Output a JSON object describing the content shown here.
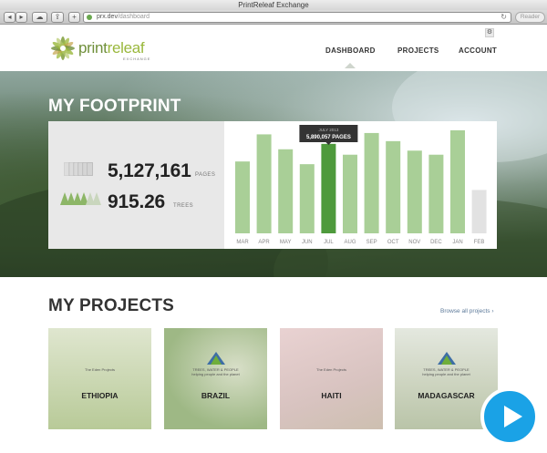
{
  "browser": {
    "window_title": "PrintReleaf Exchange",
    "url_host": "prx.dev",
    "url_path": "/dashboard",
    "reader_label": "Reader"
  },
  "header": {
    "logo_word_1": "print",
    "logo_word_2": "releaf",
    "logo_sub": "EXCHANGE",
    "nav": [
      {
        "label": "DASHBOARD",
        "active": true
      },
      {
        "label": "PROJECTS",
        "active": false
      },
      {
        "label": "ACCOUNT",
        "active": false
      }
    ]
  },
  "footprint": {
    "title": "MY FOOTPRINT",
    "pages_value": "5,127,161",
    "pages_unit": "PAGES",
    "trees_value": "915.26",
    "trees_unit": "TREES"
  },
  "chart_data": {
    "type": "bar",
    "categories": [
      "MAR",
      "APR",
      "MAY",
      "JUN",
      "JUL",
      "AUG",
      "SEP",
      "OCT",
      "NOV",
      "DEC",
      "JAN",
      "FEB"
    ],
    "series": [
      {
        "values": [
          5.3,
          7.3,
          6.2,
          5.1,
          6.6,
          5.8,
          7.4,
          6.8,
          6.1,
          5.8,
          7.6,
          3.2
        ]
      }
    ],
    "highlighted_index": 4,
    "tooltip": {
      "title": "JULY 2013",
      "value": "5,890,057 PAGES"
    },
    "colors": {
      "bar": "#a9cf97",
      "highlight": "#4e9a3c",
      "projected": "#e2e2e2",
      "tooltip_bg": "#333333"
    },
    "projected_index": 11
  },
  "projects": {
    "title": "MY PROJECTS",
    "browse_label": "Browse all projects ›",
    "items": [
      {
        "name": "ETHIOPIA",
        "partner": "The Eden Projects",
        "bg": "#c7d6b0"
      },
      {
        "name": "BRAZIL",
        "partner": "TREES, WATER & PEOPLE",
        "partner_sub": "helping people and the planet",
        "bg": "#b9cc9f"
      },
      {
        "name": "HAITI",
        "partner": "The Eden Projects",
        "bg": "#e2c9c9"
      },
      {
        "name": "MADAGASCAR",
        "partner": "TREES, WATER & PEOPLE",
        "partner_sub": "helping people and the planet",
        "bg": "#d2d8c8"
      }
    ]
  }
}
